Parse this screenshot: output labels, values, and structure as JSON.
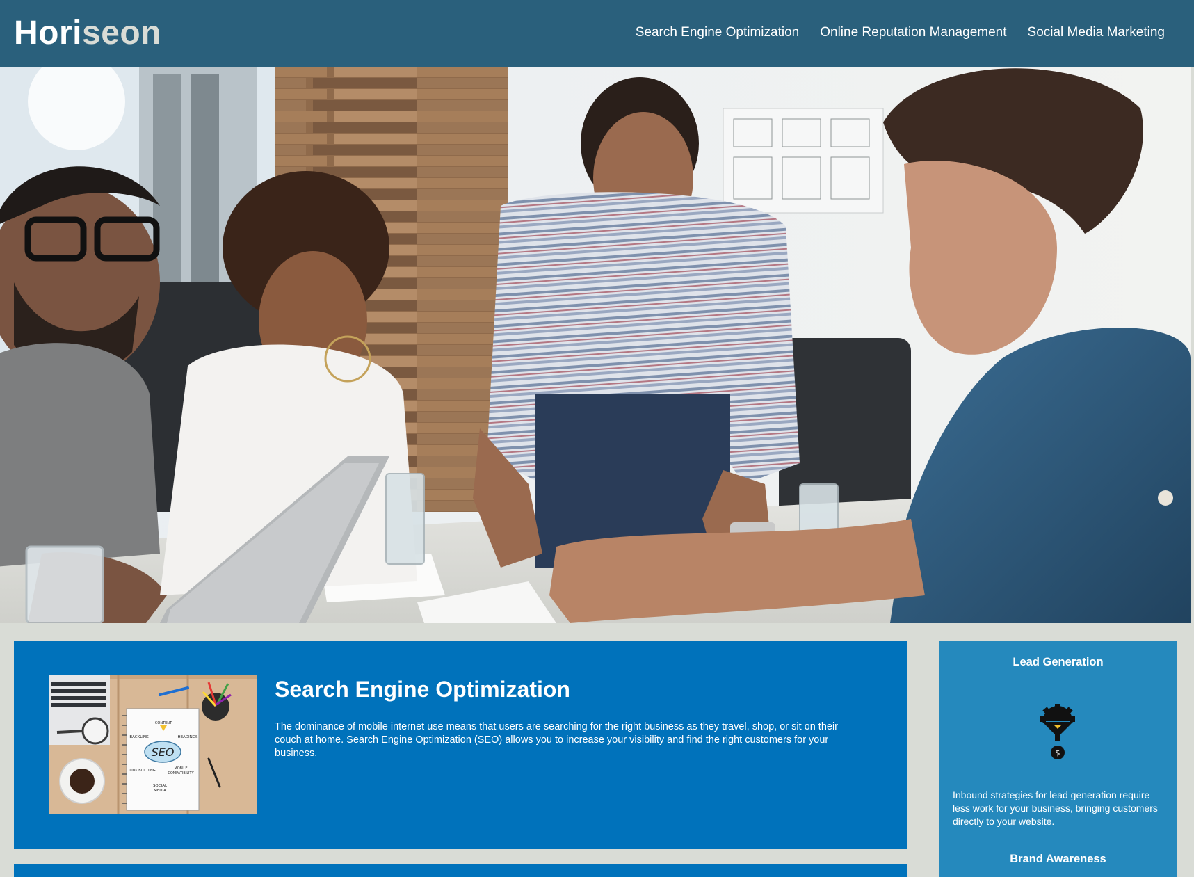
{
  "header": {
    "logo_main": "Hori",
    "logo_accent": "seon",
    "nav": [
      {
        "label": "Search Engine Optimization"
      },
      {
        "label": "Online Reputation Management"
      },
      {
        "label": "Social Media Marketing"
      }
    ]
  },
  "hero": {
    "image": "team-meeting-photo"
  },
  "content": {
    "seo": {
      "title": "Search Engine Optimization",
      "text": "The dominance of mobile internet use means that users are searching for the right business as they travel, shop, or sit on their couch at home. Search Engine Optimization (SEO) allows you to increase your visibility and find the right customers for your business.",
      "image_labels": {
        "seo": "SEO",
        "content": "CONTENT",
        "backlink": "BACKLINK",
        "headings": "HEADINGS",
        "link_building": "LINK BUILDING",
        "mobile": "MOBILE",
        "compatibility": "COMPATIBILITY",
        "social": "SOCIAL",
        "media": "MEDIA"
      }
    }
  },
  "sidebar": {
    "lead_title": "Lead Generation",
    "lead_icon": "lead-funnel-icon",
    "lead_text": "Inbound strategies for lead generation require less work for your business, bringing customers directly to your website.",
    "brand_title": "Brand Awareness"
  },
  "colors": {
    "header_bg": "#2a607c",
    "page_bg": "#d9dcd6",
    "article_bg": "#0072bb",
    "aside_bg": "#2589bd"
  }
}
